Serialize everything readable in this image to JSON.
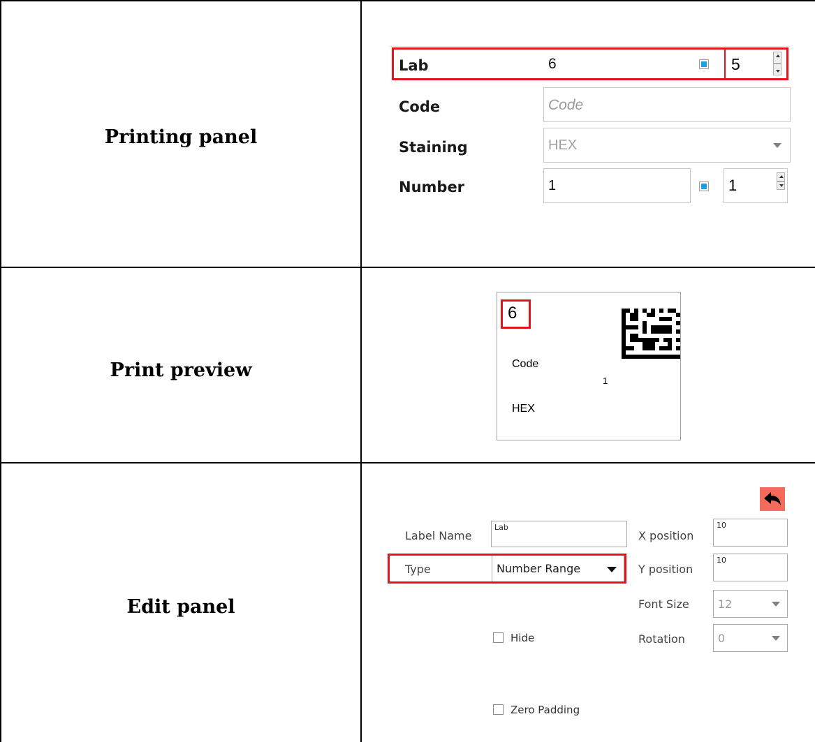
{
  "rows": {
    "printing_panel": "Printing panel",
    "print_preview": "Print preview",
    "edit_panel": "Edit panel"
  },
  "printing_panel": {
    "lab_label": "Lab",
    "lab_value": "6",
    "lab_spin_value": "5",
    "code_label": "Code",
    "code_placeholder": "Code",
    "staining_label": "Staining",
    "staining_value": "HEX",
    "number_label": "Number",
    "number_value": "1",
    "number_spin_value": "1",
    "checkbox_color": "#1ba1e2"
  },
  "print_preview": {
    "lab_value": "6",
    "code": "Code",
    "number": "1",
    "staining": "HEX"
  },
  "edit_panel": {
    "label_name_label": "Label Name",
    "label_name_value": "Lab",
    "type_label": "Type",
    "type_value": "Number Range",
    "x_position_label": "X position",
    "x_position_value": "10",
    "y_position_label": "Y position",
    "y_position_value": "10",
    "font_size_label": "Font Size",
    "font_size_value": "12",
    "rotation_label": "Rotation",
    "rotation_value": "0",
    "hide_label": "Hide",
    "zero_padding_label": "Zero Padding",
    "back_icon": "undo-arrow-icon",
    "back_button_color": "#f46b5b"
  },
  "highlight_color": "#e3141c"
}
